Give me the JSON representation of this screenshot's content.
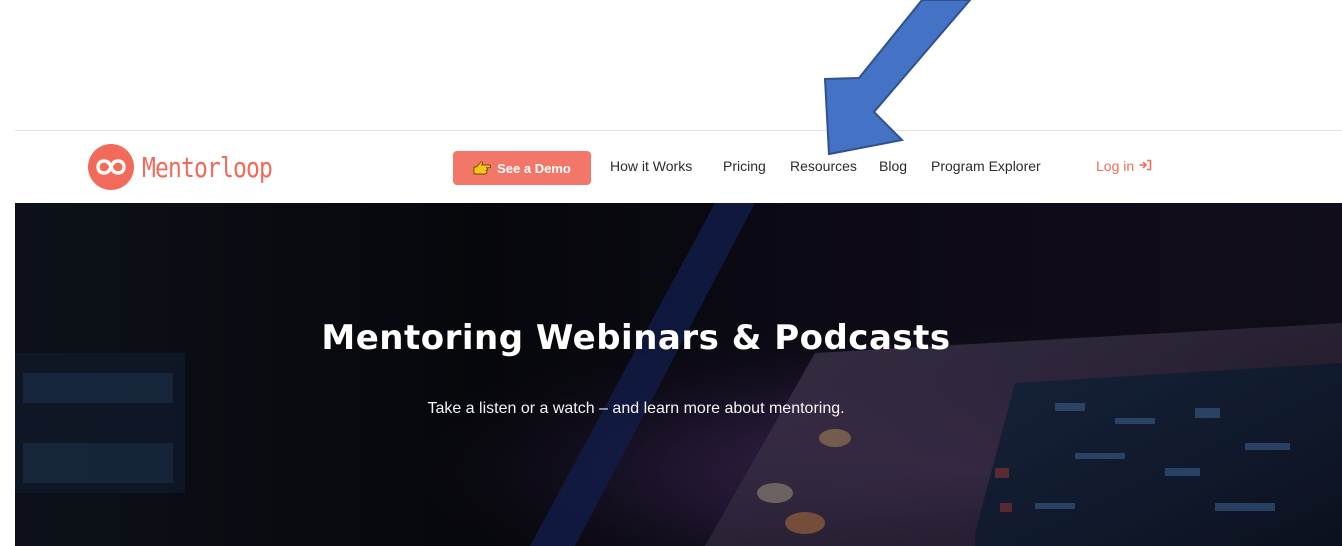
{
  "brand": {
    "name": "Mentorloop",
    "color": "#f26a5a"
  },
  "nav": {
    "demo_label": "See a Demo",
    "links": [
      {
        "label": "How it Works"
      },
      {
        "label": "Pricing"
      },
      {
        "label": "Resources"
      },
      {
        "label": "Blog"
      },
      {
        "label": "Program Explorer"
      }
    ],
    "login_label": "Log in",
    "login_icon": "login-arrow-icon",
    "demo_icon": "pointing-hand-icon"
  },
  "hero": {
    "title": "Mentoring Webinars & Podcasts",
    "subtitle": "Take a listen or a watch – and learn more about mentoring."
  },
  "annotation": {
    "icon": "blue-arrow",
    "color": "#4472c4"
  }
}
